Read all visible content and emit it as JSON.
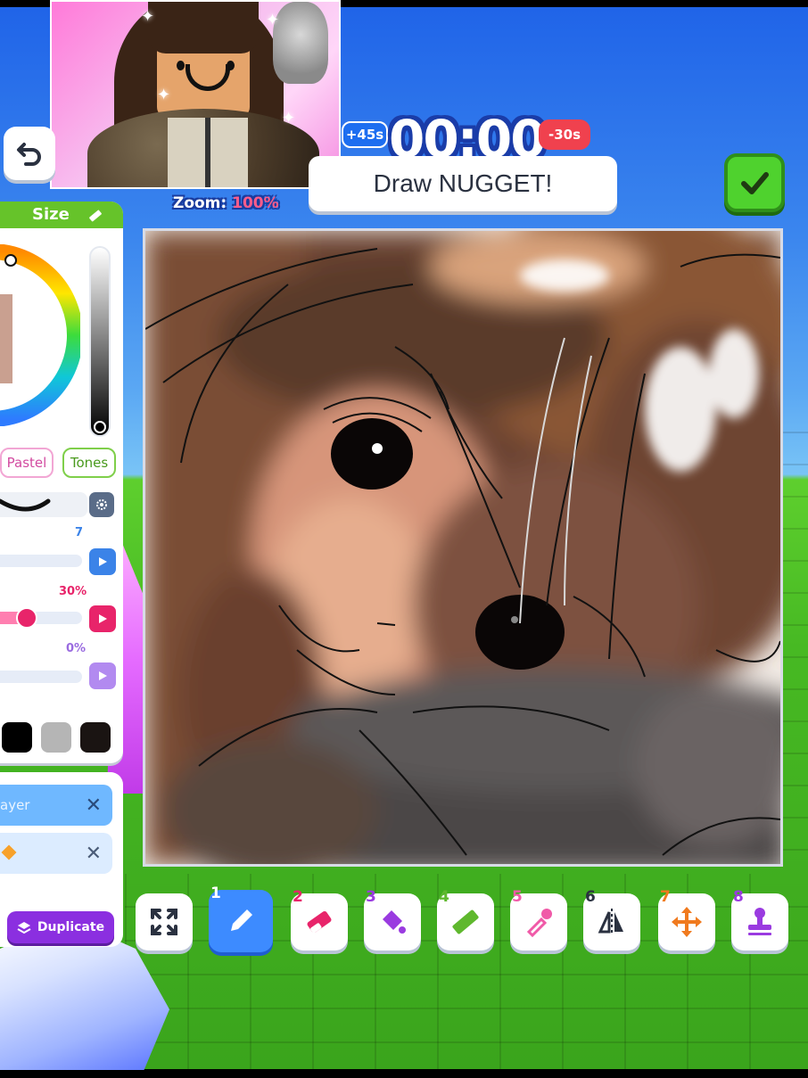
{
  "timer": {
    "value": "00:00",
    "bonus": "+45s",
    "penalty": "-30s"
  },
  "prompt": {
    "text": "Draw NUGGET!"
  },
  "zoom": {
    "label": "Zoom:",
    "value": "100%"
  },
  "panel": {
    "header": "Size",
    "modes": [
      "Pastel",
      "Tones"
    ],
    "sliders": [
      {
        "value": "7",
        "level": 0.0
      },
      {
        "value": "30%",
        "level": 0.3
      },
      {
        "value": "0%",
        "level": 0.0
      }
    ],
    "swatches": [
      "#000000",
      "#b5b5b5",
      "#1a1412"
    ]
  },
  "layers": {
    "rows": [
      {
        "name": "ayer",
        "active": true
      },
      {
        "name": "",
        "active": false
      }
    ],
    "duplicate_label": "Duplicate"
  },
  "toolbar": {
    "tools": [
      {
        "num": "",
        "icon": "fullscreen-icon"
      },
      {
        "num": "1",
        "icon": "pencil-icon",
        "active": true,
        "color": "#ffffff"
      },
      {
        "num": "2",
        "icon": "eraser-icon",
        "color": "#e8246a"
      },
      {
        "num": "3",
        "icon": "paint-bucket-icon",
        "color": "#9a3be0"
      },
      {
        "num": "4",
        "icon": "ruler-icon",
        "color": "#5fb82e"
      },
      {
        "num": "5",
        "icon": "eyedropper-icon",
        "color": "#f05aa8"
      },
      {
        "num": "6",
        "icon": "mirror-icon",
        "color": "#2a3140"
      },
      {
        "num": "7",
        "icon": "move-icon",
        "color": "#f07a1e"
      },
      {
        "num": "8",
        "icon": "stamp-icon",
        "color": "#9a3be0"
      }
    ]
  }
}
